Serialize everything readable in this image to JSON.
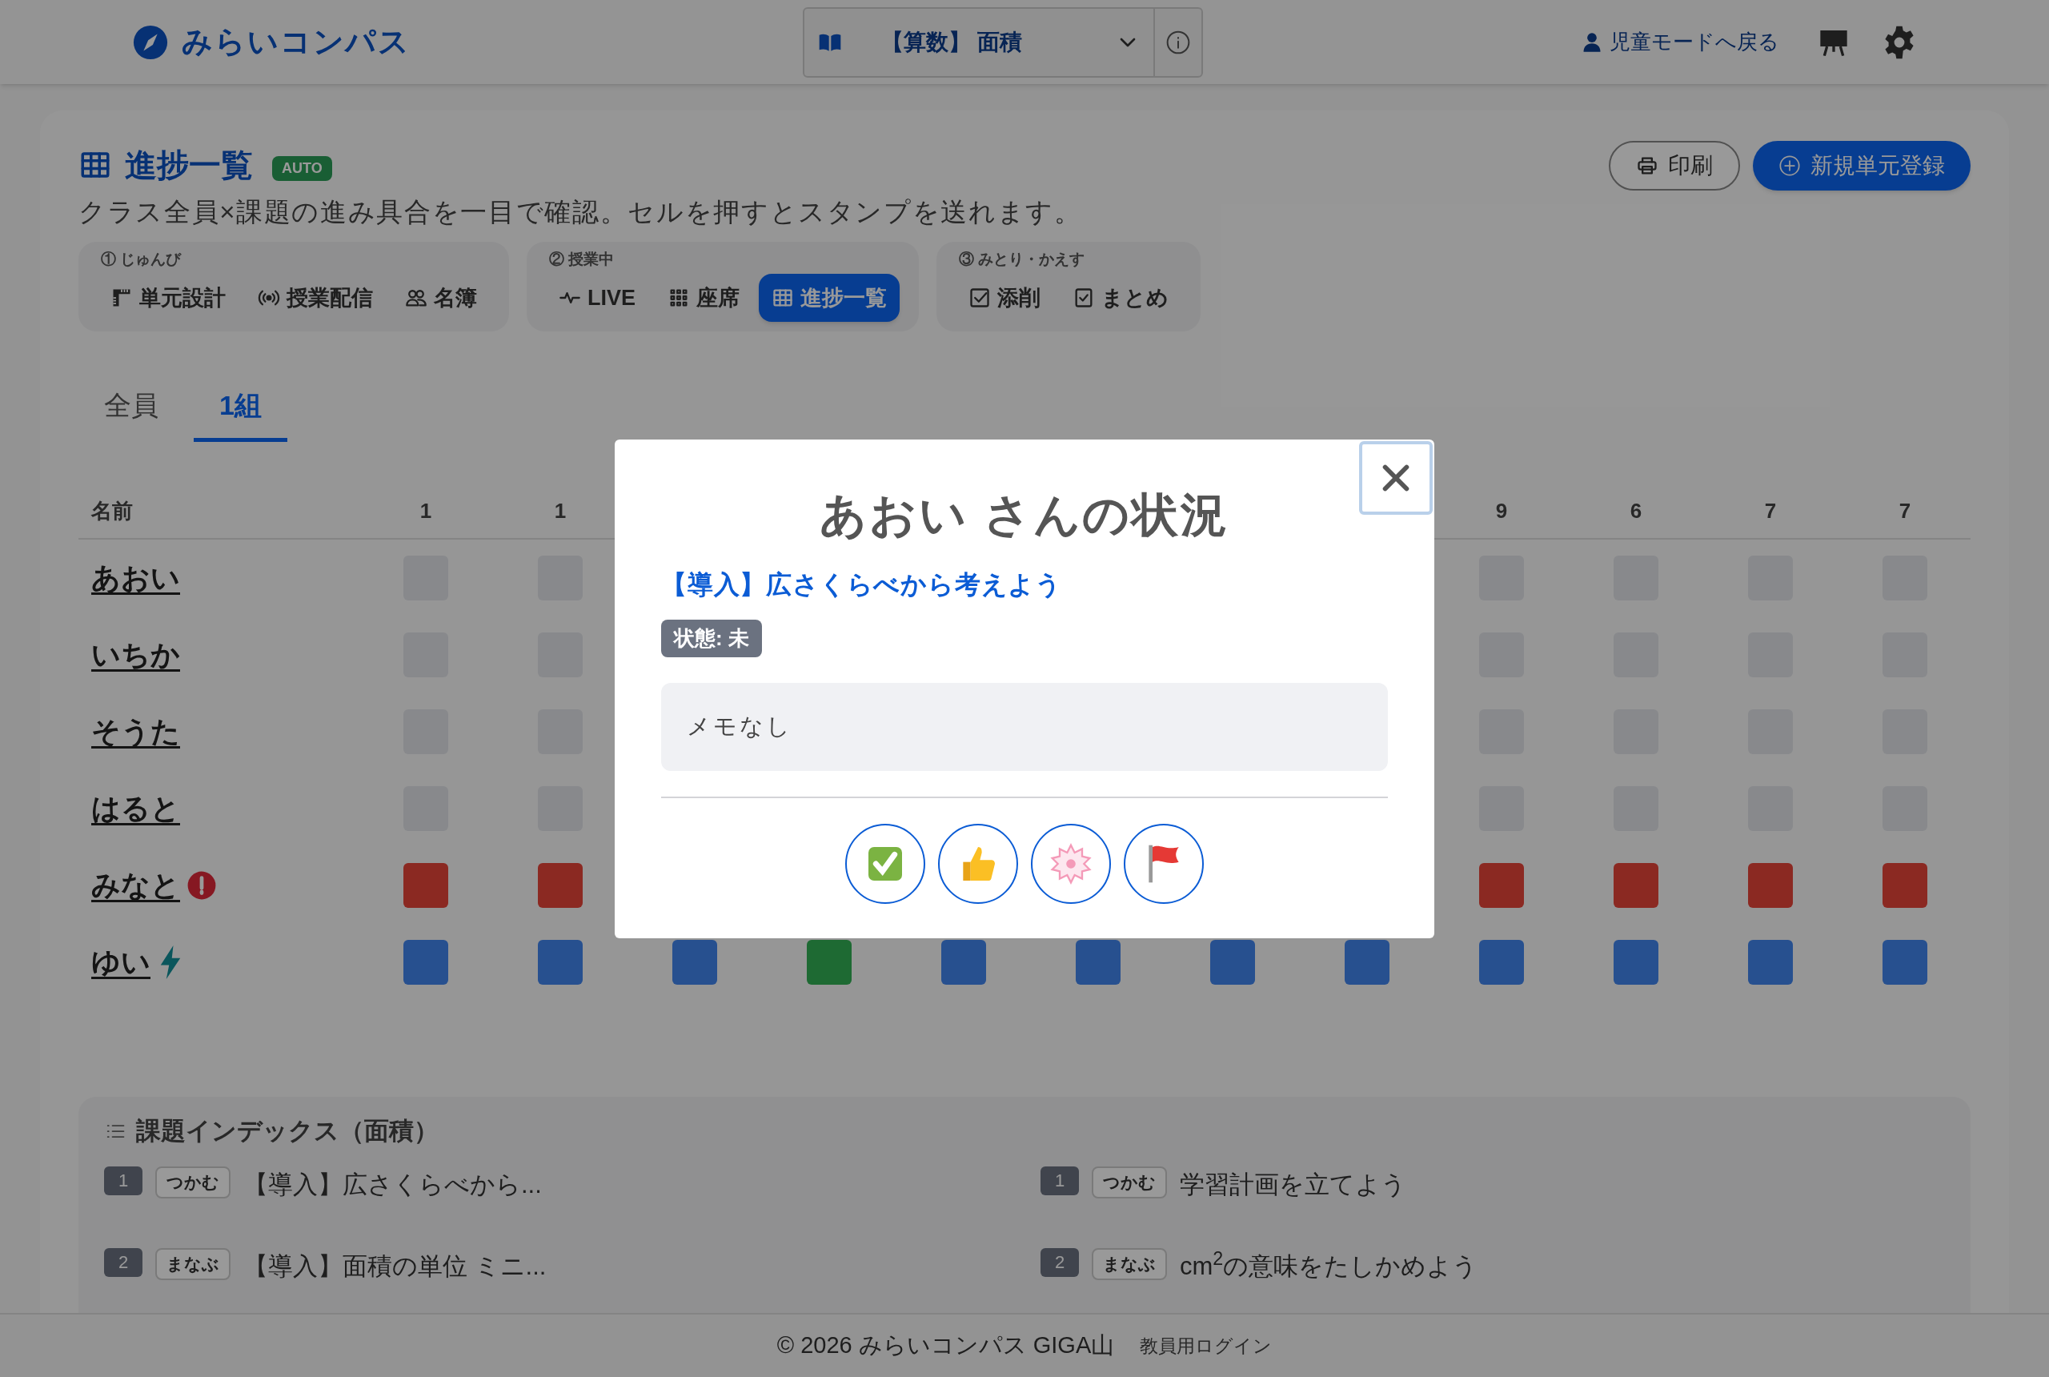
{
  "topbar": {
    "logo": "みらいコンパス",
    "unit_select": "【算数】 面積",
    "back_link": "児童モードへ戻る"
  },
  "header": {
    "title": "進捗一覧",
    "badge": "AUTO",
    "subtitle": "クラス全員×課題の進み具合を一目で確認。セルを押すとスタンプを送れます。",
    "buttons": [
      {
        "kind": "print",
        "label": "印刷"
      },
      {
        "kind": "add",
        "label": "新規単元登録"
      }
    ]
  },
  "nav_groups": [
    {
      "label": "① じゅんび",
      "items": [
        {
          "label": "単元設計",
          "selected": false
        },
        {
          "label": "授業配信",
          "selected": false
        },
        {
          "label": "名簿",
          "selected": false
        }
      ]
    },
    {
      "label": "② 授業中",
      "items": [
        {
          "label": "LIVE",
          "selected": false
        },
        {
          "label": "座席",
          "selected": false
        },
        {
          "label": "進捗一覧",
          "selected": true
        }
      ]
    },
    {
      "label": "③ みとり・かえす",
      "items": [
        {
          "label": "添削",
          "selected": false
        },
        {
          "label": "まとめ",
          "selected": false
        }
      ]
    }
  ],
  "tabs": [
    {
      "label": "全員",
      "selected": false
    },
    {
      "label": "1組",
      "selected": true
    }
  ],
  "table": {
    "name_header": "名前",
    "columns": [
      "1",
      "1",
      null,
      null,
      null,
      null,
      null,
      null,
      "9",
      "6",
      "7",
      "7"
    ],
    "rows": [
      {
        "name": "あおい",
        "cells": [
          {
            "kind": "todo"
          },
          {
            "kind": "todo"
          },
          null,
          null,
          null,
          null,
          null,
          null,
          {
            "kind": "todo"
          },
          {
            "kind": "todo"
          },
          {
            "kind": "todo"
          },
          {
            "kind": "todo"
          }
        ]
      },
      {
        "name": "いちか",
        "cells": [
          {
            "kind": "todo"
          },
          {
            "kind": "todo"
          },
          null,
          null,
          null,
          null,
          null,
          null,
          {
            "kind": "todo"
          },
          {
            "kind": "todo"
          },
          {
            "kind": "todo"
          },
          {
            "kind": "todo"
          }
        ]
      },
      {
        "name": "そうた",
        "cells": [
          {
            "kind": "todo"
          },
          {
            "kind": "todo"
          },
          null,
          null,
          null,
          null,
          null,
          null,
          {
            "kind": "todo"
          },
          {
            "kind": "todo"
          },
          {
            "kind": "todo"
          },
          {
            "kind": "todo"
          }
        ]
      },
      {
        "name": "はると",
        "cells": [
          {
            "kind": "todo"
          },
          {
            "kind": "todo"
          },
          null,
          null,
          null,
          null,
          null,
          null,
          {
            "kind": "todo"
          },
          {
            "kind": "todo"
          },
          {
            "kind": "todo"
          },
          {
            "kind": "todo"
          }
        ]
      },
      {
        "name": "みなと",
        "kind": "alert",
        "cells": [
          {
            "kind": "help"
          },
          {
            "kind": "help"
          },
          null,
          null,
          null,
          null,
          null,
          null,
          {
            "kind": "help"
          },
          {
            "kind": "help"
          },
          {
            "kind": "help"
          },
          {
            "kind": "help"
          }
        ]
      },
      {
        "name": "ゆい",
        "kind": "fast",
        "cells": [
          {
            "kind": "done"
          },
          {
            "kind": "done"
          },
          {
            "kind": "done"
          },
          {
            "kind": "check"
          },
          {
            "kind": "done"
          },
          {
            "kind": "done"
          },
          {
            "kind": "done"
          },
          {
            "kind": "done"
          },
          {
            "kind": "done"
          },
          {
            "kind": "done"
          },
          {
            "kind": "done"
          },
          {
            "kind": "done"
          }
        ]
      }
    ]
  },
  "index": {
    "title": "課題インデックス（面積）",
    "items": [
      {
        "number": "1",
        "phase": "つかむ",
        "title": "【導入】広さくらべから..."
      },
      {
        "number": "1",
        "phase": "つかむ",
        "title": "学習計画を立てよう"
      },
      {
        "number": "2",
        "phase": "まなぶ",
        "title": "【導入】面積の単位 ミニ..."
      },
      {
        "number": "2",
        "phase": "まなぶ",
        "title": "cm$^{2}$の意味をたしかめよう"
      }
    ]
  },
  "footer": {
    "copyright": "© 2026 みらいコンパス GIGA山",
    "login_link": "教員用ログイン"
  },
  "modal": {
    "title": "あおい さんの状況",
    "task": "【導入】広さくらべから考えよう",
    "status": "状態: 未",
    "memo": "メモなし",
    "stamps": [
      {
        "kind": "check"
      },
      {
        "kind": "thumbs"
      },
      {
        "kind": "flower"
      },
      {
        "kind": "flag"
      }
    ]
  }
}
